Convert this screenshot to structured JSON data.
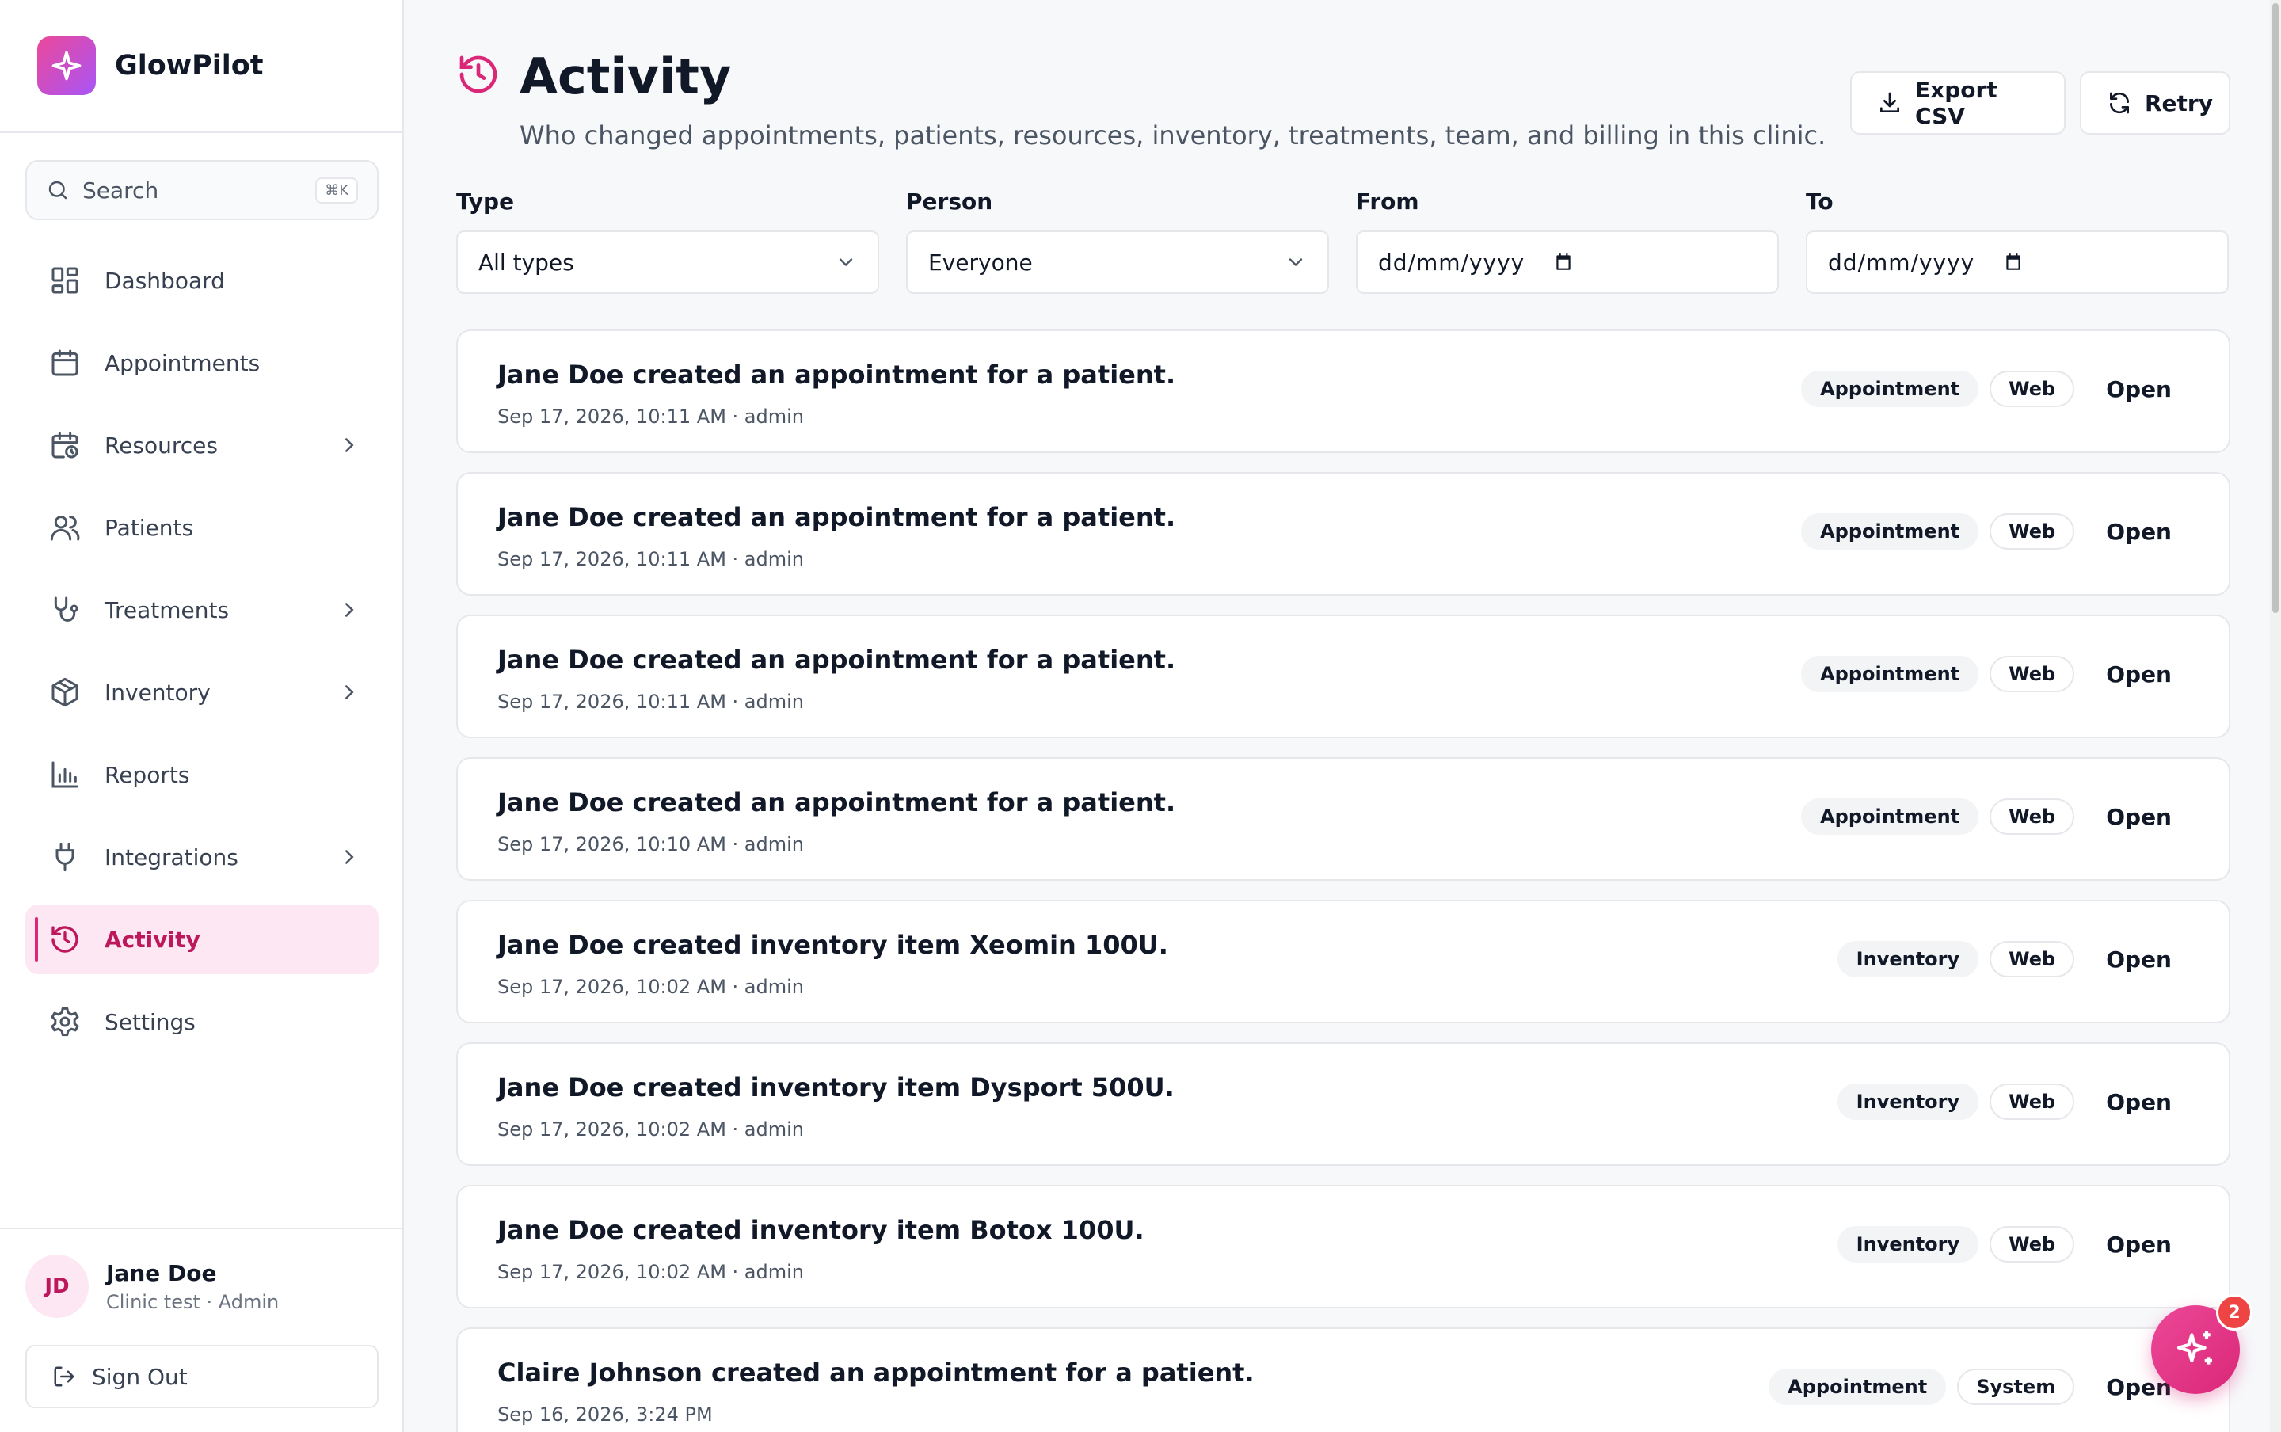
{
  "app": {
    "name": "GlowPilot"
  },
  "search": {
    "placeholder": "Search",
    "shortcut": "⌘K"
  },
  "sidebar": {
    "items": [
      {
        "label": "Dashboard",
        "icon": "dashboard-icon",
        "has_submenu": false
      },
      {
        "label": "Appointments",
        "icon": "calendar-icon",
        "has_submenu": false
      },
      {
        "label": "Resources",
        "icon": "calendar-clock-icon",
        "has_submenu": true
      },
      {
        "label": "Patients",
        "icon": "users-icon",
        "has_submenu": false
      },
      {
        "label": "Treatments",
        "icon": "stethoscope-icon",
        "has_submenu": true
      },
      {
        "label": "Inventory",
        "icon": "box-icon",
        "has_submenu": true
      },
      {
        "label": "Reports",
        "icon": "bar-chart-icon",
        "has_submenu": false
      },
      {
        "label": "Integrations",
        "icon": "plug-icon",
        "has_submenu": true
      },
      {
        "label": "Activity",
        "icon": "history-icon",
        "has_submenu": false,
        "active": true
      },
      {
        "label": "Settings",
        "icon": "gear-icon",
        "has_submenu": false
      }
    ]
  },
  "user": {
    "initials": "JD",
    "name": "Jane Doe",
    "role": "Clinic test · Admin"
  },
  "signout": {
    "label": "Sign Out"
  },
  "page": {
    "title": "Activity",
    "subtitle": "Who changed appointments, patients, resources, inventory, treatments, team, and billing in this clinic."
  },
  "actions": {
    "export_label": "Export CSV",
    "retry_label": "Retry"
  },
  "filters": {
    "type": {
      "label": "Type",
      "value": "All types"
    },
    "person": {
      "label": "Person",
      "value": "Everyone"
    },
    "from": {
      "label": "From",
      "value": "dd/mm/yyyy"
    },
    "to": {
      "label": "To",
      "value": "dd/mm/yyyy"
    }
  },
  "activities": [
    {
      "title": "Jane Doe created an appointment for a patient.",
      "meta": "Sep 17, 2026, 10:11 AM · admin",
      "type": "Appointment",
      "source": "Web",
      "action": "Open"
    },
    {
      "title": "Jane Doe created an appointment for a patient.",
      "meta": "Sep 17, 2026, 10:11 AM · admin",
      "type": "Appointment",
      "source": "Web",
      "action": "Open"
    },
    {
      "title": "Jane Doe created an appointment for a patient.",
      "meta": "Sep 17, 2026, 10:11 AM · admin",
      "type": "Appointment",
      "source": "Web",
      "action": "Open"
    },
    {
      "title": "Jane Doe created an appointment for a patient.",
      "meta": "Sep 17, 2026, 10:10 AM · admin",
      "type": "Appointment",
      "source": "Web",
      "action": "Open"
    },
    {
      "title": "Jane Doe created inventory item Xeomin 100U.",
      "meta": "Sep 17, 2026, 10:02 AM · admin",
      "type": "Inventory",
      "source": "Web",
      "action": "Open"
    },
    {
      "title": "Jane Doe created inventory item Dysport 500U.",
      "meta": "Sep 17, 2026, 10:02 AM · admin",
      "type": "Inventory",
      "source": "Web",
      "action": "Open"
    },
    {
      "title": "Jane Doe created inventory item Botox 100U.",
      "meta": "Sep 17, 2026, 10:02 AM · admin",
      "type": "Inventory",
      "source": "Web",
      "action": "Open"
    },
    {
      "title": "Claire Johnson created an appointment for a patient.",
      "meta": "Sep 16, 2026, 3:24 PM",
      "type": "Appointment",
      "source": "System",
      "action": "Open"
    }
  ],
  "assistant": {
    "badge_count": "2",
    "icon": "sparkles-icon"
  },
  "colors": {
    "accent": "#db2777",
    "accent_bg": "#fce7f3",
    "badge": "#ef4444"
  }
}
